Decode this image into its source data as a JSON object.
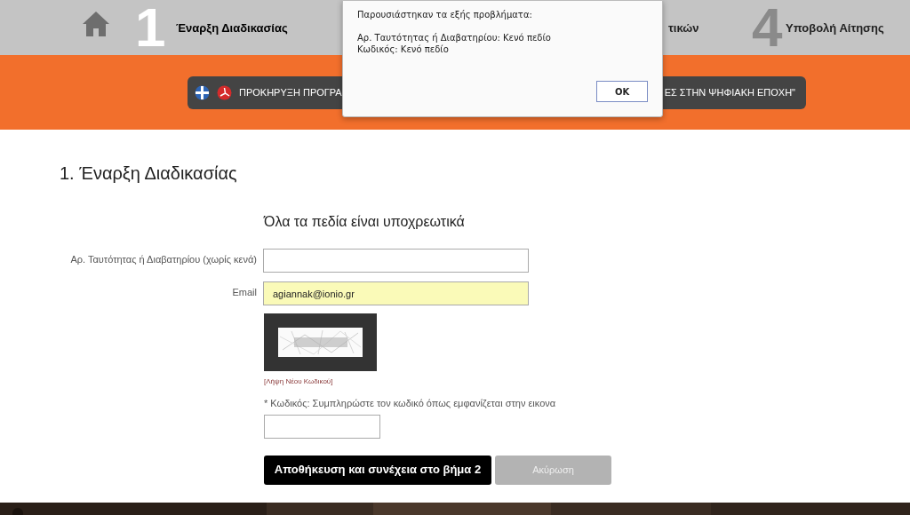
{
  "steps": [
    {
      "number": "1",
      "label": "Έναρξη Διαδικασίας",
      "selected": true
    },
    {
      "label": "τικών",
      "selected": false
    },
    {
      "number": "4",
      "label": "Υποβολή Αίτησης",
      "selected": false
    }
  ],
  "banner": {
    "text_left": "ΠΡΟΚΗΡΥΞΗ ΠΡΟΓΡΑ",
    "text_right": "ΕΣ ΣΤΗΝ ΨΗΦΙΑΚΗ ΕΠΟΧΗ\""
  },
  "dialog": {
    "intro": "Παρουσιάστηκαν τα εξής προβλήματα:",
    "errors": [
      "Αρ. Ταυτότητας ή Διαβατηρίου: Κενό πεδίο",
      "Κωδικός: Κενό πεδίο"
    ],
    "ok": "OK"
  },
  "page_title": "1. Έναρξη Διαδικασίας",
  "form": {
    "subtitle": "Όλα τα πεδία είναι υποχρεωτικά",
    "fields": [
      {
        "label": "Αρ. Ταυτότητας ή Διαβατηρίου (χωρίς κενά)",
        "highlighted": false
      },
      {
        "label": "Email",
        "value": "agiannak@ionio.gr",
        "highlighted": true
      }
    ],
    "new_code_link": "[Λήψη Νέου Κωδικού]",
    "code_label": "* Κωδικός: Συμπληρώστε τον κωδικό όπως εμφανίζεται στην εικονα",
    "buttons": [
      {
        "label": "Αποθήκευση και συνέχεια στο βήμα 2",
        "kind": "primary"
      },
      {
        "label": "Ακύρωση",
        "kind": "secondary"
      }
    ]
  }
}
